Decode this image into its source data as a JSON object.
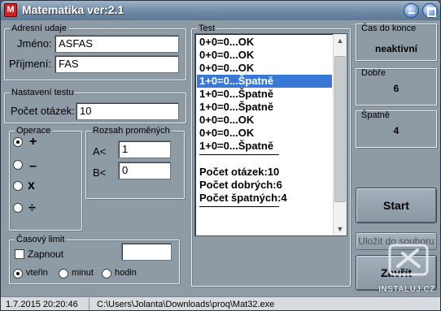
{
  "window": {
    "title": "Matematika  ver:2.1",
    "app_icon_glyph": "M"
  },
  "address": {
    "group_label": "Adresní udaje",
    "first_name_label": "Jméno:",
    "first_name_value": "ASFAS",
    "last_name_label": "Příjmení:",
    "last_name_value": "FAS"
  },
  "settings": {
    "group_label": "Nastavení testu",
    "question_count_label": "Počet otázek:",
    "question_count_value": "10"
  },
  "operations": {
    "group_label": "Operace",
    "items": [
      {
        "glyph": "+",
        "checked": true,
        "icon": "plus-icon"
      },
      {
        "glyph": "–",
        "checked": false,
        "icon": "minus-icon"
      },
      {
        "glyph": "x",
        "checked": false,
        "icon": "multiply-icon"
      },
      {
        "glyph": "÷",
        "checked": false,
        "icon": "divide-icon"
      }
    ]
  },
  "range": {
    "group_label": "Rozsah proměných",
    "a_label": "A<",
    "a_value": "1",
    "b_label": "B<",
    "b_value": "0"
  },
  "time_limit": {
    "group_label": "Časový limit",
    "enable_label": "Zapnout",
    "enable_checked": false,
    "value": "",
    "units": [
      {
        "label": "vteřin",
        "checked": true
      },
      {
        "label": "minut",
        "checked": false
      },
      {
        "label": "hodin",
        "checked": false
      }
    ]
  },
  "test": {
    "group_label": "Test",
    "lines": [
      {
        "text": "0+0=0...OK",
        "selected": false
      },
      {
        "text": "0+0=0...OK",
        "selected": false
      },
      {
        "text": "0+0=0...OK",
        "selected": false
      },
      {
        "text": "1+0=0...Špatně",
        "selected": true
      },
      {
        "text": "1+0=0...Špatně",
        "selected": false
      },
      {
        "text": "1+0=0...Špatně",
        "selected": false
      },
      {
        "text": "0+0=0...OK",
        "selected": false
      },
      {
        "text": "0+0=0...OK",
        "selected": false
      },
      {
        "text": "1+0=0...Špatně",
        "selected": false
      },
      {
        "text": "",
        "separator": true
      },
      {
        "text": "",
        "spacer": true
      },
      {
        "text": "Počet otázek:10",
        "selected": false
      },
      {
        "text": "Počet dobrých:6",
        "selected": false
      },
      {
        "text": "Počet špatných:4",
        "selected": false
      },
      {
        "text": "",
        "separator": true
      }
    ],
    "scroll_position": 0.3
  },
  "countdown": {
    "label": "Čas do konce",
    "value": "neaktivní"
  },
  "correct": {
    "label": "Dobře",
    "value": "6"
  },
  "wrong": {
    "label": "Špatně",
    "value": "4"
  },
  "buttons": {
    "start": "Start",
    "save": "Uložit do souboru",
    "close": "Zavřít"
  },
  "status": {
    "datetime": "1.7.2015 20:20:46",
    "path": "C:\\Users\\Jolanta\\Downloads\\proq\\Mat32.exe"
  },
  "watermark": {
    "text": "INSTALUJ.CZ"
  }
}
